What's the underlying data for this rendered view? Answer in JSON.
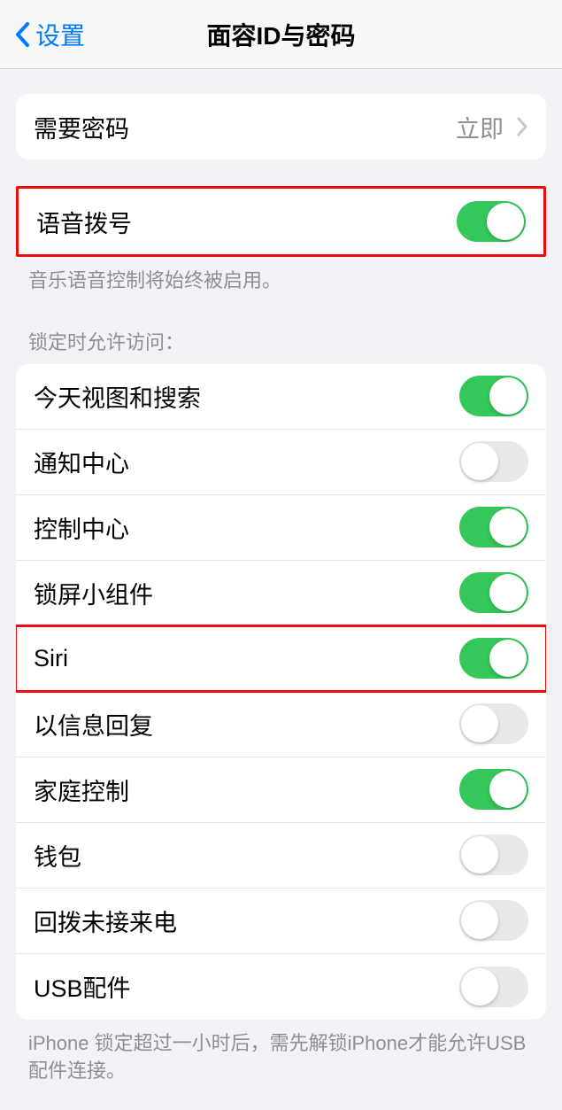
{
  "header": {
    "back_label": "设置",
    "title": "面容ID与密码"
  },
  "passcode_section": {
    "require_passcode_label": "需要密码",
    "require_passcode_value": "立即"
  },
  "voice_section": {
    "voice_dial_label": "语音拨号",
    "voice_dial_on": true,
    "footer": "音乐语音控制将始终被启用。"
  },
  "lock_access": {
    "header": "锁定时允许访问：",
    "items": [
      {
        "label": "今天视图和搜索",
        "on": true
      },
      {
        "label": "通知中心",
        "on": false
      },
      {
        "label": "控制中心",
        "on": true
      },
      {
        "label": "锁屏小组件",
        "on": true
      },
      {
        "label": "Siri",
        "on": true,
        "highlighted": true
      },
      {
        "label": "以信息回复",
        "on": false
      },
      {
        "label": "家庭控制",
        "on": true
      },
      {
        "label": "钱包",
        "on": false
      },
      {
        "label": "回拨未接来电",
        "on": false
      },
      {
        "label": "USB配件",
        "on": false
      }
    ],
    "footer": "iPhone 锁定超过一小时后，需先解锁iPhone才能允许USB 配件连接。"
  }
}
